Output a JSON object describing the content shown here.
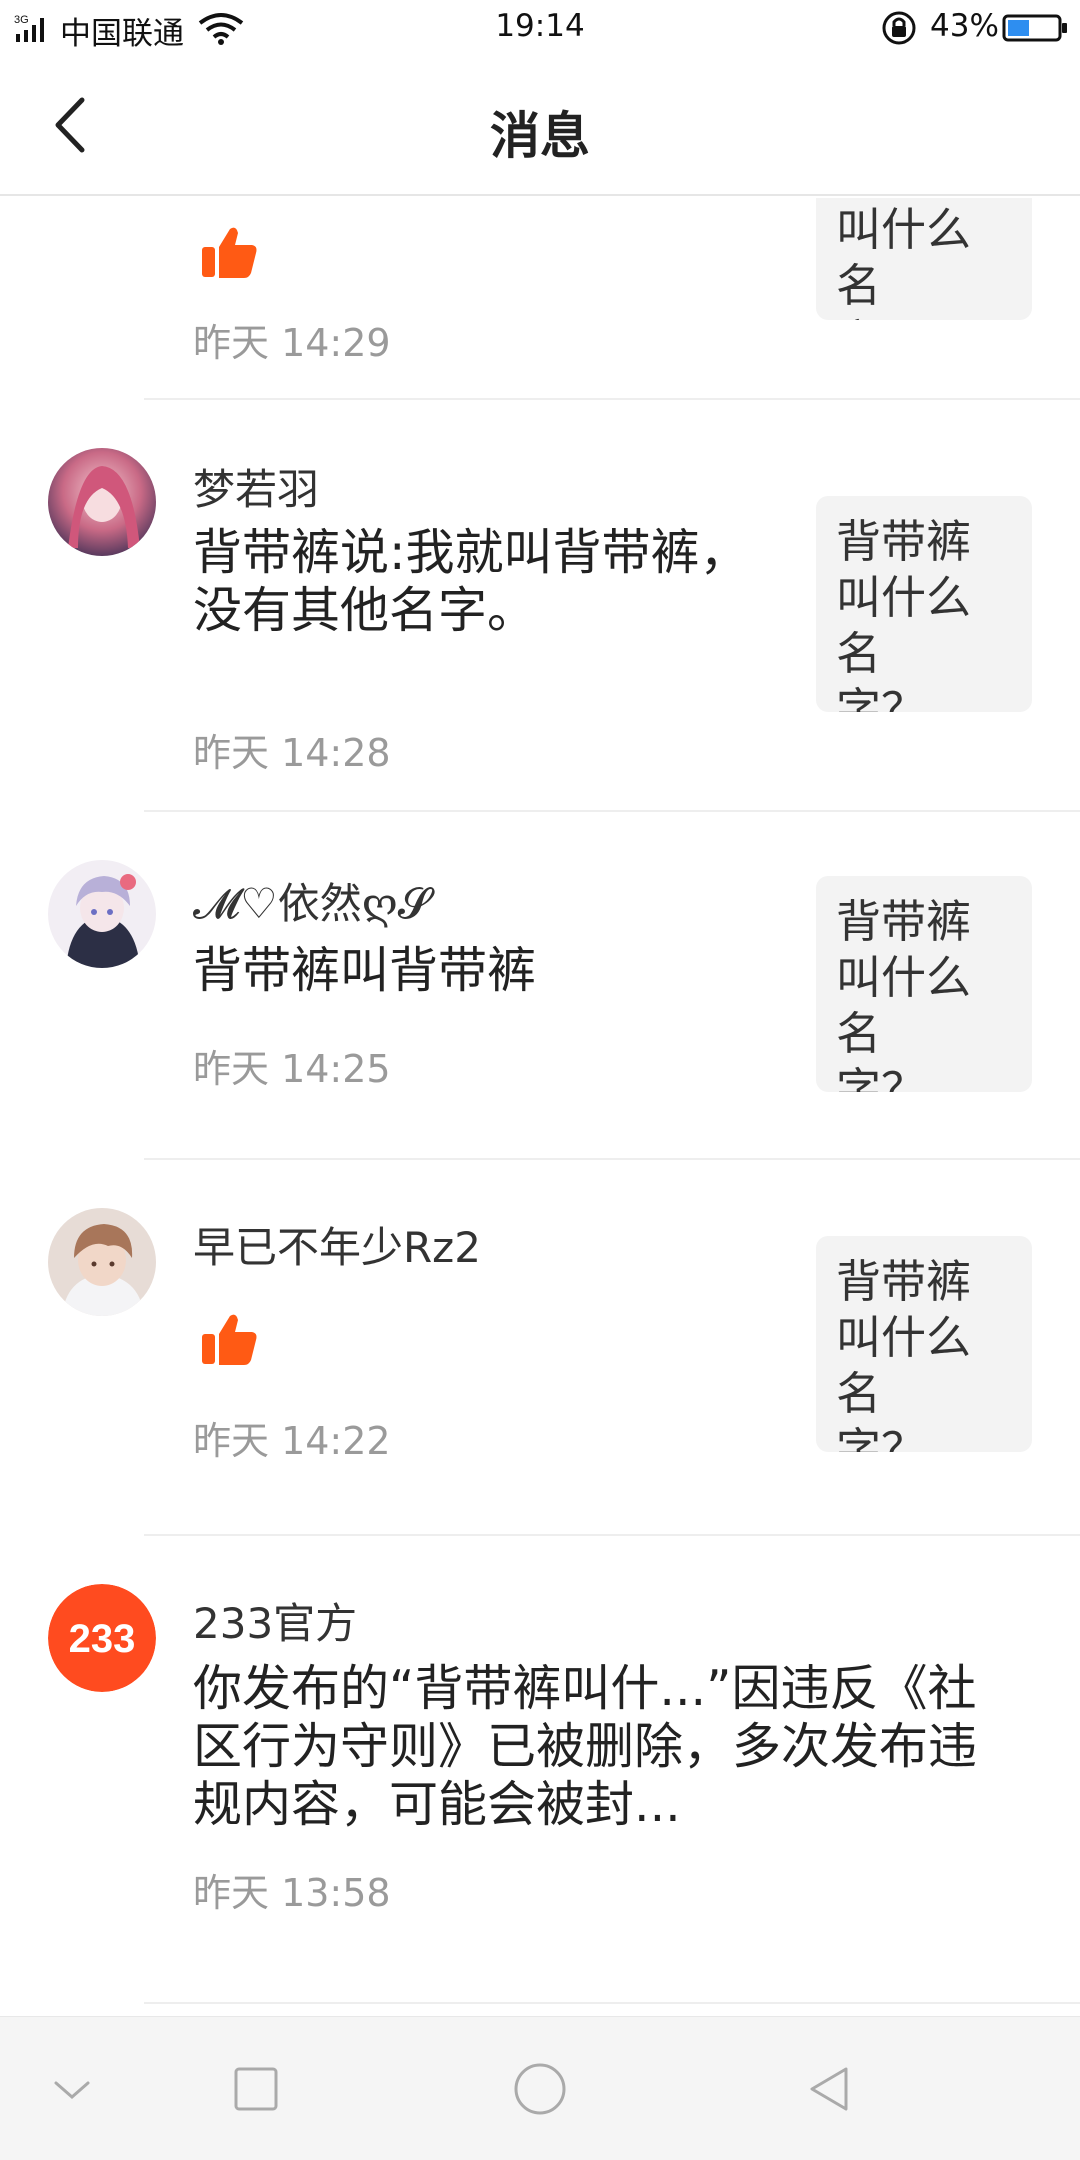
{
  "status_bar": {
    "network": "3G",
    "carrier": "中国联通",
    "time": "19:14",
    "battery": "43%",
    "battery_level": 0.43
  },
  "header": {
    "title": "消息"
  },
  "messages": [
    {
      "user": "",
      "text": "",
      "liked": true,
      "time": "昨天 14:29",
      "thumb": "背带裤叫什么名字？..."
    },
    {
      "user": "梦若羽",
      "text": "背带裤说:我就叫背带裤，没有其他名字。",
      "liked": false,
      "time": "昨天 14:28",
      "thumb": "背带裤叫什么名字？..."
    },
    {
      "user": "𝓜♡依然ღ𝓢",
      "text": "背带裤叫背带裤",
      "liked": false,
      "time": "昨天 14:25",
      "thumb": "背带裤叫什么名字？..."
    },
    {
      "user": "早已不年少Rz2",
      "text": "",
      "liked": true,
      "time": "昨天 14:22",
      "thumb": "背带裤叫什么名字？..."
    },
    {
      "user": "233官方",
      "avatar_text": "233",
      "text": "你发布的“背带裤叫什...”因违反《社区行为守则》已被删除，多次发布违规内容，可能会被封...",
      "liked": false,
      "time": "昨天 13:58",
      "thumb": ""
    }
  ],
  "icons": {
    "back": "chevron-left-icon",
    "like": "thumbs-up-icon",
    "nav": [
      "chevron-down-icon",
      "square-icon",
      "circle-icon",
      "triangle-back-icon"
    ]
  },
  "colors": {
    "like": "#ff5a14",
    "brand_233": "#ff4b1f",
    "timestamp": "#9a9a9a",
    "thumb_bg": "#f3f3f3"
  }
}
